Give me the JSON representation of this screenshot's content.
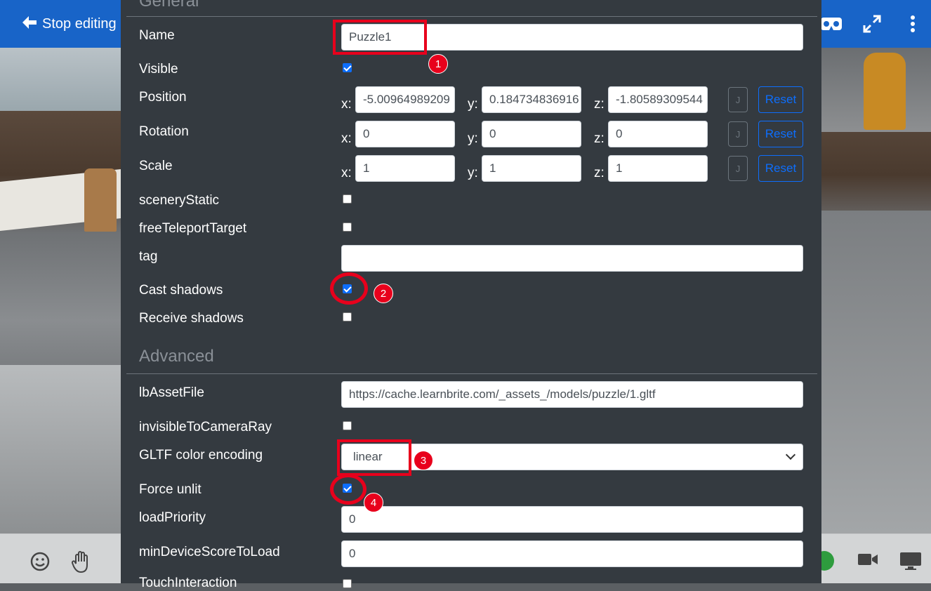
{
  "topbar": {
    "stop_editing_label": "Stop editing",
    "icons": [
      "vr-headset-icon",
      "fullscreen-icon",
      "more-vertical-icon"
    ]
  },
  "panel": {
    "general_title": "General",
    "advanced_title": "Advanced",
    "name": {
      "label": "Name",
      "value": "Puzzle1"
    },
    "visible": {
      "label": "Visible",
      "checked": true
    },
    "position": {
      "label": "Position",
      "x": "-5.00964989209",
      "y": "0.184734836916",
      "z": "-1.80589309544",
      "j_label": "J",
      "reset_label": "Reset"
    },
    "rotation": {
      "label": "Rotation",
      "x": "0",
      "y": "0",
      "z": "0",
      "j_label": "J",
      "reset_label": "Reset"
    },
    "scale": {
      "label": "Scale",
      "x": "1",
      "y": "1",
      "z": "1",
      "j_label": "J",
      "reset_label": "Reset"
    },
    "axis_labels": {
      "x": "x:",
      "y": "y:",
      "z": "z:"
    },
    "scenery_static": {
      "label": "sceneryStatic",
      "checked": false
    },
    "free_teleport_target": {
      "label": "freeTeleportTarget",
      "checked": false
    },
    "tag": {
      "label": "tag",
      "value": ""
    },
    "cast_shadows": {
      "label": "Cast shadows",
      "checked": true
    },
    "receive_shadows": {
      "label": "Receive shadows",
      "checked": false
    },
    "lb_asset_file": {
      "label": "lbAssetFile",
      "value": "https://cache.learnbrite.com/_assets_/models/puzzle/1.gltf"
    },
    "invisible_to_camera_ray": {
      "label": "invisibleToCameraRay",
      "checked": false
    },
    "gltf_color_encoding": {
      "label": "GLTF color encoding",
      "value": "linear"
    },
    "force_unlit": {
      "label": "Force unlit",
      "checked": true
    },
    "load_priority": {
      "label": "loadPriority",
      "value": "0"
    },
    "min_device_score_to_load": {
      "label": "minDeviceScoreToLoad",
      "value": "0"
    },
    "touch_interaction": {
      "label": "TouchInteraction"
    }
  },
  "annotations": [
    "1",
    "2",
    "3",
    "4"
  ],
  "bottombar": {
    "icons": [
      "emoji-icon",
      "raise-hand-icon",
      "phone-icon",
      "camera-icon",
      "screen-share-icon"
    ]
  },
  "colors": {
    "topbar": "#1864c8",
    "panel": "#343a40",
    "accent": "#0d6efd",
    "highlight": "#e8001c"
  }
}
